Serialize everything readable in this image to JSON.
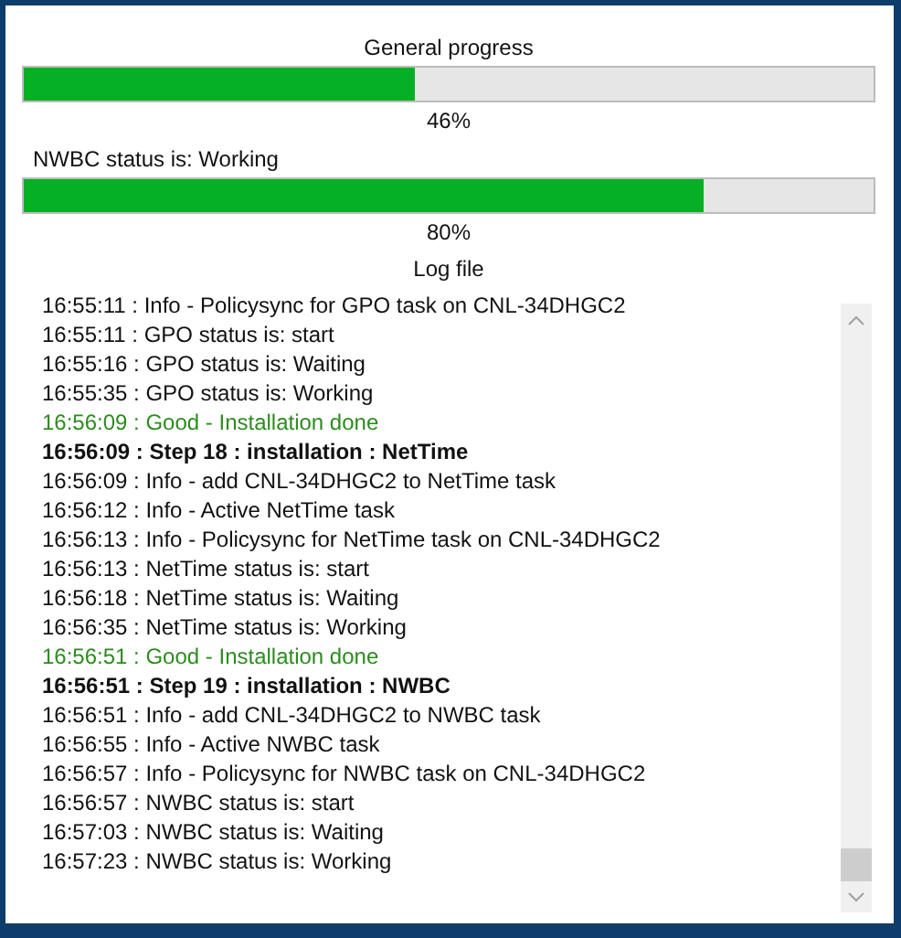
{
  "general_progress": {
    "title": "General progress",
    "level": 0.46,
    "reading": "46%"
  },
  "task_progress": {
    "status": "NWBC status is: Working",
    "level": 0.8,
    "reading": "80%"
  },
  "log": {
    "title": "Log file",
    "lines": [
      {
        "kind": "info",
        "text": "16:55:11 : Info - Policysync for GPO task on CNL-34DHGC2"
      },
      {
        "kind": "info",
        "text": "16:55:11 : GPO status is: start"
      },
      {
        "kind": "info",
        "text": "16:55:16 : GPO status is: Waiting"
      },
      {
        "kind": "info",
        "text": "16:55:35 : GPO status is: Working"
      },
      {
        "kind": "good",
        "text": "16:56:09 : Good - Installation done"
      },
      {
        "kind": "step",
        "text": "16:56:09 : Step 18 : installation : NetTime"
      },
      {
        "kind": "info",
        "text": "16:56:09 : Info - add CNL-34DHGC2 to NetTime task"
      },
      {
        "kind": "info",
        "text": "16:56:12 : Info - Active NetTime task"
      },
      {
        "kind": "info",
        "text": "16:56:13 : Info - Policysync for NetTime task on CNL-34DHGC2"
      },
      {
        "kind": "info",
        "text": "16:56:13 : NetTime status is: start"
      },
      {
        "kind": "info",
        "text": "16:56:18 : NetTime status is: Waiting"
      },
      {
        "kind": "info",
        "text": "16:56:35 : NetTime status is: Working"
      },
      {
        "kind": "good",
        "text": "16:56:51 : Good - Installation done"
      },
      {
        "kind": "step",
        "text": "16:56:51 : Step 19 : installation : NWBC"
      },
      {
        "kind": "info",
        "text": "16:56:51 : Info - add CNL-34DHGC2 to NWBC task"
      },
      {
        "kind": "info",
        "text": "16:56:55 : Info - Active NWBC task"
      },
      {
        "kind": "info",
        "text": "16:56:57 : Info - Policysync for NWBC task on CNL-34DHGC2"
      },
      {
        "kind": "info",
        "text": "16:56:57 : NWBC status is: start"
      },
      {
        "kind": "info",
        "text": "16:57:03 : NWBC status is: Waiting"
      },
      {
        "kind": "info",
        "text": "16:57:23 : NWBC status is: Working"
      }
    ]
  }
}
